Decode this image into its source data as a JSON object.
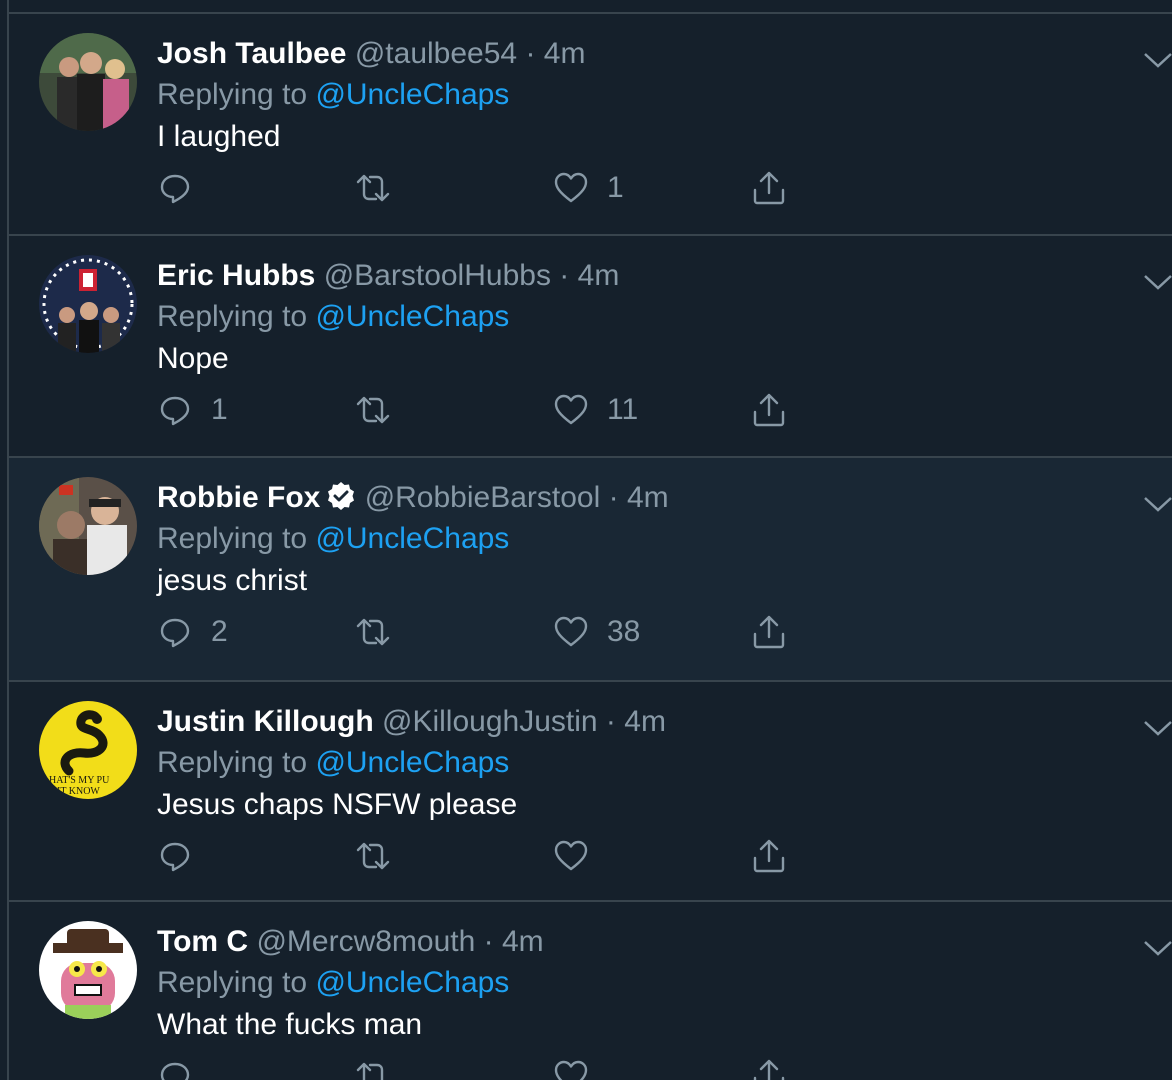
{
  "tweets": [
    {
      "name": "Josh Taulbee",
      "handle": "@taulbee54",
      "dot": "·",
      "time": "4m",
      "replying_prefix": "Replying to ",
      "replying_to": "@UncleChaps",
      "text": "I laughed",
      "reply_count": "",
      "retweet_count": "",
      "like_count": "1",
      "verified": false
    },
    {
      "name": "Eric Hubbs",
      "handle": "@BarstoolHubbs",
      "dot": "·",
      "time": "4m",
      "replying_prefix": "Replying to ",
      "replying_to": "@UncleChaps",
      "text": "Nope",
      "reply_count": "1",
      "retweet_count": "",
      "like_count": "11",
      "verified": false
    },
    {
      "name": "Robbie Fox",
      "handle": "@RobbieBarstool",
      "dot": "·",
      "time": "4m",
      "replying_prefix": "Replying to ",
      "replying_to": "@UncleChaps",
      "text": "jesus christ",
      "reply_count": "2",
      "retweet_count": "",
      "like_count": "38",
      "verified": true
    },
    {
      "name": "Justin Killough",
      "handle": "@KilloughJustin",
      "dot": "·",
      "time": "4m",
      "replying_prefix": "Replying to ",
      "replying_to": "@UncleChaps",
      "text": "Jesus chaps NSFW please",
      "reply_count": "",
      "retweet_count": "",
      "like_count": "",
      "verified": false,
      "avatar_text_1": "HAT'S MY PU",
      "avatar_text_2": "IT KNOW"
    },
    {
      "name": "Tom C",
      "handle": "@Mercw8mouth",
      "dot": "·",
      "time": "4m",
      "replying_prefix": "Replying to ",
      "replying_to": "@UncleChaps",
      "text": "What the fucks man",
      "reply_count": "",
      "retweet_count": "",
      "like_count": "",
      "verified": false
    }
  ],
  "colors": {
    "background": "#15202b",
    "highlight_background": "#192734",
    "border": "#38444d",
    "text": "#ffffff",
    "secondary": "#8899a6",
    "accent": "#1da1f2"
  },
  "icons": {
    "reply": "reply-icon",
    "retweet": "retweet-icon",
    "like": "heart-icon",
    "share": "share-icon",
    "menu": "chevron-down-icon",
    "verified": "verified-badge-icon"
  }
}
